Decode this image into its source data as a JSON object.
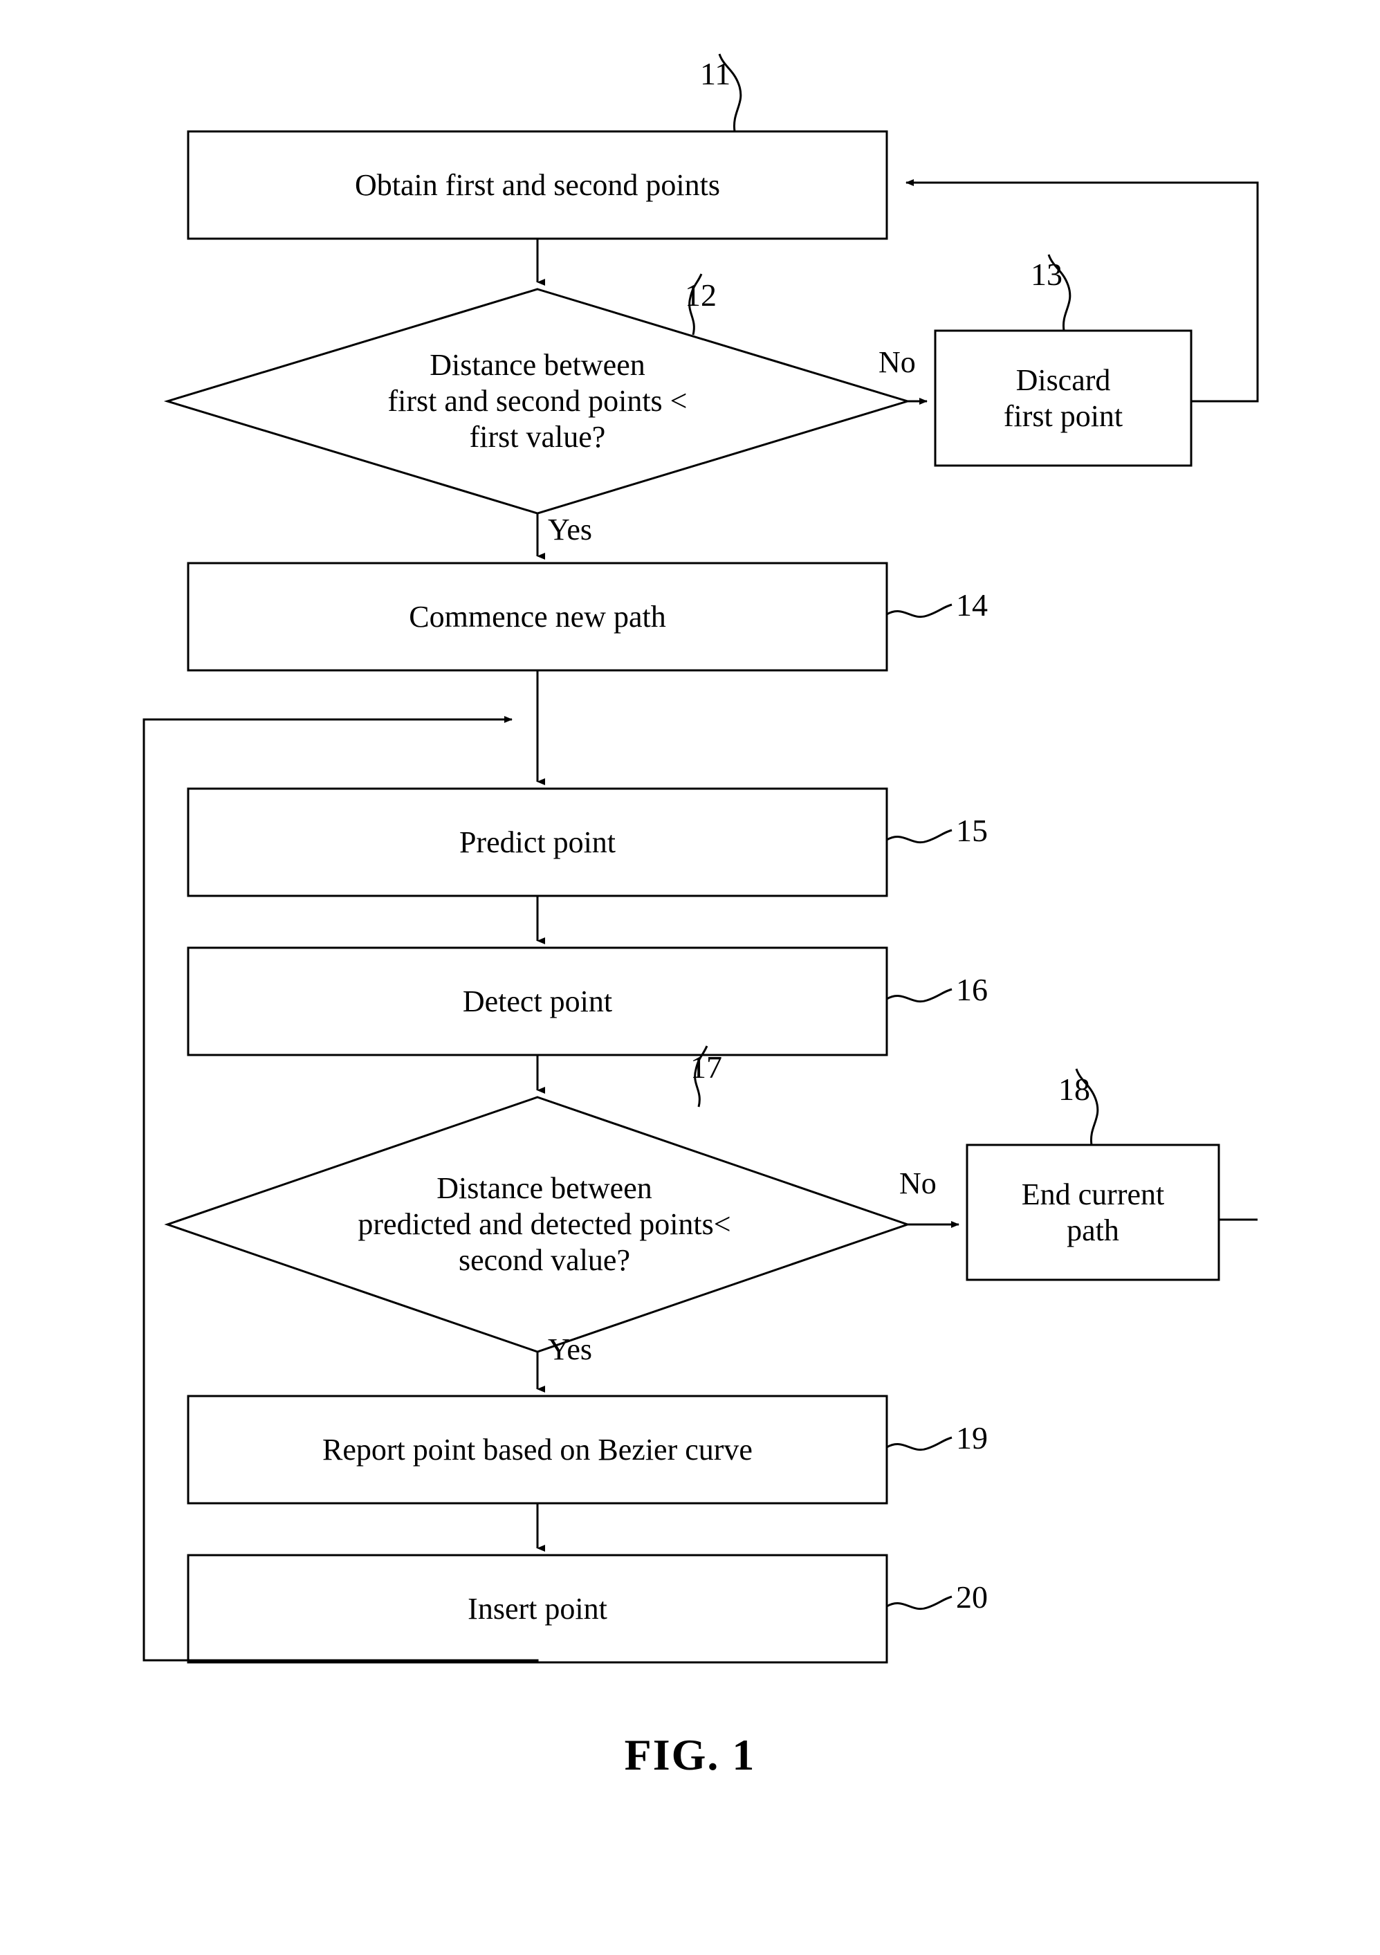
{
  "figure": {
    "caption": "FIG. 1",
    "nodes": [
      {
        "id": "n11",
        "ref": "11",
        "type": "process",
        "label": "Obtain first and second points"
      },
      {
        "id": "n12",
        "ref": "12",
        "type": "decision",
        "label": "Distance between\nfirst and second points <\nfirst value?"
      },
      {
        "id": "n13",
        "ref": "13",
        "type": "process",
        "label": "Discard\nfirst point"
      },
      {
        "id": "n14",
        "ref": "14",
        "type": "process",
        "label": "Commence new path"
      },
      {
        "id": "n15",
        "ref": "15",
        "type": "process",
        "label": "Predict point"
      },
      {
        "id": "n16",
        "ref": "16",
        "type": "process",
        "label": "Detect point"
      },
      {
        "id": "n17",
        "ref": "17",
        "type": "decision",
        "label": "Distance between\npredicted and detected points<\nsecond value?"
      },
      {
        "id": "n18",
        "ref": "18",
        "type": "process",
        "label": "End current\npath"
      },
      {
        "id": "n19",
        "ref": "19",
        "type": "process",
        "label": "Report point based on Bezier curve"
      },
      {
        "id": "n20",
        "ref": "20",
        "type": "process",
        "label": "Insert point"
      }
    ],
    "edge_labels": [
      {
        "id": "e12no",
        "label": "No"
      },
      {
        "id": "e12yes",
        "label": "Yes"
      },
      {
        "id": "e17no",
        "label": "No"
      },
      {
        "id": "e17yes",
        "label": "Yes"
      }
    ]
  }
}
